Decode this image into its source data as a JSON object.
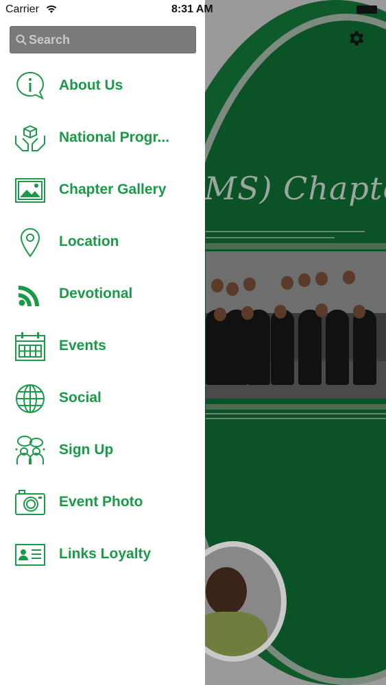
{
  "status_bar": {
    "carrier": "Carrier",
    "time": "8:31 AM"
  },
  "search": {
    "placeholder": "Search"
  },
  "menu": {
    "items": [
      {
        "label": "About Us",
        "icon": "info-bubble-icon"
      },
      {
        "label": "National Progr...",
        "icon": "hands-box-icon"
      },
      {
        "label": "Chapter Gallery",
        "icon": "picture-icon"
      },
      {
        "label": "Location",
        "icon": "map-pin-icon"
      },
      {
        "label": "Devotional",
        "icon": "rss-icon"
      },
      {
        "label": "Events",
        "icon": "calendar-icon"
      },
      {
        "label": "Social",
        "icon": "globe-icon"
      },
      {
        "label": "Sign Up",
        "icon": "people-chat-icon"
      },
      {
        "label": "Event Photo",
        "icon": "camera-icon"
      },
      {
        "label": "Links Loyalty",
        "icon": "id-card-icon"
      }
    ]
  },
  "background": {
    "title_fragment": "MS) Chapter"
  },
  "colors": {
    "accent": "#1a9a48",
    "background_green": "#0f5a2a"
  }
}
